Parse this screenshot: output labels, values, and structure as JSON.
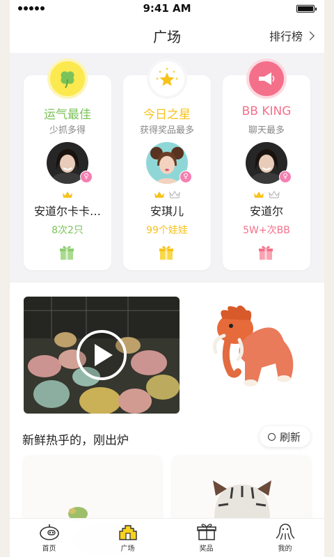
{
  "status_bar": {
    "time": "9:41 AM"
  },
  "header": {
    "title": "广场",
    "rank_link": "排行榜"
  },
  "colors": {
    "green": "#7cc25a",
    "yellow": "#f7c21a",
    "pink": "#f4708a",
    "gender_female": "#f47fb1"
  },
  "leaderboard": [
    {
      "title": "运气最佳",
      "desc": "少抓多得",
      "winner": "安道尔卡卡…",
      "stat": "8次2只",
      "icon": "clover-icon",
      "crowns": 1
    },
    {
      "title": "今日之星",
      "desc": "获得奖品最多",
      "winner": "安琪儿",
      "stat": "99个娃娃",
      "icon": "star-icon",
      "crowns": 2
    },
    {
      "title": "BB KING",
      "desc": "聊天最多",
      "winner": "安道尔",
      "stat": "5W+次BB",
      "icon": "megaphone-icon",
      "crowns": 2
    }
  ],
  "fresh": {
    "title": "新鲜热乎的，刚出炉",
    "refresh": "刷新"
  },
  "tabbar": [
    {
      "label": "首页",
      "icon": "robot-face-icon",
      "active": false
    },
    {
      "label": "广场",
      "icon": "castle-icon",
      "active": true
    },
    {
      "label": "奖品",
      "icon": "gift-box-icon",
      "active": false
    },
    {
      "label": "我的",
      "icon": "octopus-icon",
      "active": false
    }
  ]
}
